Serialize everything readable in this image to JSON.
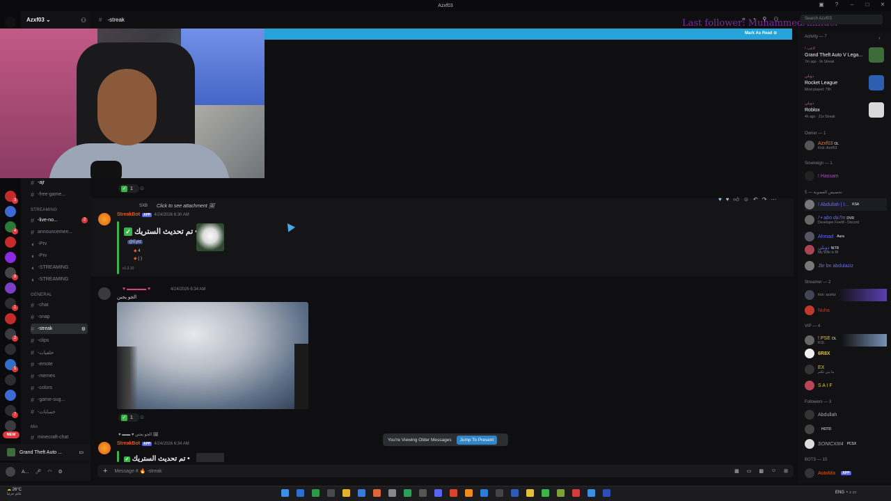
{
  "window": {
    "title": "Azxf03"
  },
  "server": {
    "name": "Azxf03"
  },
  "header": {
    "channel": "-streak"
  },
  "overlay": {
    "last_follower": "Last follower: MuhammedAlkhder"
  },
  "search": {
    "placeholder": "Search Azxf03"
  },
  "banner": {
    "mark_read": "Mark As Read"
  },
  "channels": {
    "top": [
      {
        "label": "-ajr"
      },
      {
        "label": "-free-game..."
      }
    ],
    "streaming_label": "STREAMING",
    "streaming": [
      {
        "label": "-live-no...",
        "badge": "2"
      },
      {
        "label": "announcemen..."
      },
      {
        "label": "-Prv"
      },
      {
        "label": "-Prv"
      },
      {
        "label": "-STREAMING"
      },
      {
        "label": "-STREAMING"
      }
    ],
    "general_label": "GENERAL",
    "general": [
      {
        "label": "-chat"
      },
      {
        "label": "-snap"
      },
      {
        "label": "-streak"
      },
      {
        "label": "-clips"
      },
      {
        "label": "-خلفيات"
      },
      {
        "label": "-emote"
      },
      {
        "label": "-memes"
      },
      {
        "label": "-colors"
      },
      {
        "label": "-game-sug..."
      },
      {
        "label": "-خسابات"
      }
    ],
    "min_label": "Min",
    "min": [
      {
        "label": "minecraft-chat"
      }
    ]
  },
  "rail": {
    "new_label": "NEW"
  },
  "game_panel": {
    "label": "Grand Theft Auto ..."
  },
  "user_panel": {
    "name": "A..."
  },
  "messages": {
    "m1_reaction_count": "1",
    "m2_reply": "Click to see attachment",
    "m2_reply_user": "SXB",
    "m2_author": "StreakBot",
    "m2_app": "APP",
    "m2_time": "4/24/2026 6:30 AM",
    "m2_embed_title": "تم تحديث الستريك •",
    "m2_mention": "@Eyld",
    "m2_line1": "4",
    "m2_line2": "( )",
    "m2_version": "v1.3.10",
    "m3_time": "4/24/2026 6:34 AM",
    "m3_text": "الجو يجنن",
    "m3_reaction_count": "1",
    "m4_reply": "الجو يجنن",
    "m4_author": "StreakBot",
    "m4_app": "APP",
    "m4_time": "4/24/2026 6:34 AM",
    "m4_embed_title": "تم تحديث الستريك •"
  },
  "older_banner": {
    "text": "You're Viewing Older Messages",
    "jump": "Jump To Present"
  },
  "composer": {
    "placeholder": "Message # 🔥 -streak"
  },
  "members": {
    "activity_label": "Activity — 7",
    "activities": [
      {
        "who": "! لاعب",
        "game": "Grand Theft Auto V Lega...",
        "meta": "7m ago · 9x Streak",
        "color": "#3d6b39"
      },
      {
        "who": "دوبلي",
        "game": "Rocket League",
        "meta": "Most played: 79h",
        "color": "#2d5fb0"
      },
      {
        "who": "دوبلي",
        "game": "Roblox",
        "meta": "4h ago · 21x Streak",
        "color": "#d9d9d9"
      }
    ],
    "owner_label": "Owner — 1",
    "owner": [
      {
        "name": "Azxf03",
        "tag": "OL",
        "sub": "Kick: Azxf03",
        "color": "#e07b2f"
      }
    ],
    "sovereign_label": "Sovereign — 1",
    "sovereign": [
      {
        "name": "! Hassam",
        "color": "#b04bd6"
      }
    ],
    "mid_label": "تخصيص العضوية — 5",
    "mid": [
      {
        "name": "! Abdullah | I...",
        "tag": "KSA",
        "color": "#6a6cf0"
      },
      {
        "name": "! • abo da7m",
        "tag": "DVR",
        "sub": "Developer FiveM - Discord",
        "color": "#6a6cf0"
      },
      {
        "name": "Ahmad",
        "tag": "Aura",
        "color": "#6a6cf0"
      },
      {
        "name": "دوبلي",
        "tag": "NITR",
        "sub": "My Wife is RI",
        "color": "#6a6cf0"
      },
      {
        "name": "Jbr bn abdulaziz",
        "color": "#6a6cf0"
      }
    ],
    "streamer_label": "Streamer — 2",
    "streamer": [
      {
        "name": "",
        "sub": "kick: azsiful",
        "color": "#9a5bd8"
      },
      {
        "name": "Nuha",
        "color": "#c0392b"
      }
    ],
    "vip_label": "VIP — 4",
    "vip": [
      {
        "name": "! PSE",
        "tag": "OL",
        "sub": "KOL",
        "color": "#e2c03a"
      },
      {
        "name": "6R8X",
        "color": "#e2c03a"
      },
      {
        "name": "EX",
        "sub": "ما يبي تكلم",
        "color": "#e2c03a"
      },
      {
        "name": "S A I F",
        "color": "#e2c03a"
      }
    ],
    "followers_label": "Followers — 3",
    "followers": [
      {
        "name": "Abdullah",
        "color": "#a4a7ad"
      },
      {
        "name": "",
        "tag": "HOTD",
        "color": "#3cb44a"
      },
      {
        "name": "SONICXIII4",
        "tag": "PCSX",
        "color": "#a4a7ad"
      }
    ],
    "bots_label": "BOTS — 15",
    "bots": [
      {
        "name": "AutoMix",
        "tag": "APP",
        "color": "#e35a1c"
      }
    ]
  },
  "taskbar": {
    "temp": "26°C",
    "weather": "غائم جزئيا",
    "lang": "ENG"
  }
}
